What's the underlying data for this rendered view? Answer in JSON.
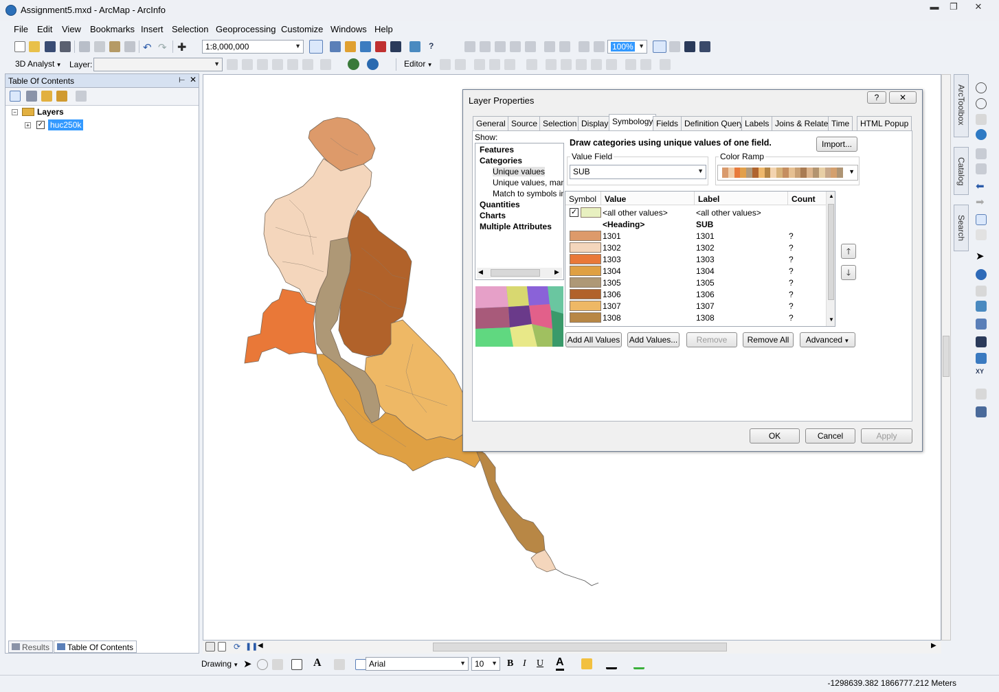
{
  "window": {
    "title": "Assignment5.mxd - ArcMap - ArcInfo",
    "minimize_glyph": "▬",
    "maximize_glyph": "❐",
    "close_glyph": "✕"
  },
  "menu": [
    "File",
    "Edit",
    "View",
    "Bookmarks",
    "Insert",
    "Selection",
    "Geoprocessing",
    "Customize",
    "Windows",
    "Help"
  ],
  "standard_toolbar": {
    "scale": "1:8,000,000",
    "zoom_percent": "100%"
  },
  "toolbar2": {
    "analyst_label": "3D Analyst",
    "layer_label": "Layer:",
    "editor_label": "Editor"
  },
  "toc": {
    "title": "Table Of Contents",
    "root_label": "Layers",
    "layer_name": "huc250k",
    "tabs": [
      "Results",
      "Table Of Contents"
    ]
  },
  "dialog": {
    "title": "Layer Properties",
    "help_glyph": "?",
    "close_glyph": "✕",
    "tabs": [
      "General",
      "Source",
      "Selection",
      "Display",
      "Symbology",
      "Fields",
      "Definition Query",
      "Labels",
      "Joins & Relates",
      "Time",
      "HTML Popup"
    ],
    "active_tab": "Symbology",
    "show_label": "Show:",
    "show_items": [
      {
        "label": "Features",
        "bold": true
      },
      {
        "label": "Categories",
        "bold": true
      },
      {
        "label": "Unique values",
        "bold": false
      },
      {
        "label": "Unique values, many",
        "bold": false
      },
      {
        "label": "Match to symbols in a",
        "bold": false
      },
      {
        "label": "Quantities",
        "bold": true
      },
      {
        "label": "Charts",
        "bold": true
      },
      {
        "label": "Multiple Attributes",
        "bold": true
      }
    ],
    "description": "Draw categories using unique values of one field.",
    "import_label": "Import...",
    "value_field_label": "Value Field",
    "value_field_value": "SUB",
    "color_ramp_label": "Color Ramp",
    "color_ramp": [
      "#d99a6c",
      "#f0cda8",
      "#e87a3c",
      "#e2a04a",
      "#b09a7c",
      "#b0642e",
      "#eeb86c",
      "#b48444",
      "#f3d4b0",
      "#d7b27a",
      "#c58e60",
      "#e6c092",
      "#c9a074",
      "#a97b52",
      "#dcb48c",
      "#b39470",
      "#e8cfa6",
      "#c8a88a",
      "#d4a06e",
      "#ae9474"
    ],
    "grid_headers": [
      "Symbol",
      "Value",
      "Label",
      "Count"
    ],
    "grid_rows": [
      {
        "value": "<all other values>",
        "label": "<all other values>",
        "count": "",
        "color": "#e8f0c0",
        "checked": true,
        "heading": false
      },
      {
        "value": "<Heading>",
        "label": "SUB",
        "count": "",
        "color": "",
        "checked": false,
        "heading": true
      },
      {
        "value": "1301",
        "label": "1301",
        "count": "?",
        "color": "#dd9a6a",
        "checked": false,
        "heading": false
      },
      {
        "value": "1302",
        "label": "1302",
        "count": "?",
        "color": "#f4d6bc",
        "checked": false,
        "heading": false
      },
      {
        "value": "1303",
        "label": "1303",
        "count": "?",
        "color": "#e97838",
        "checked": false,
        "heading": false
      },
      {
        "value": "1304",
        "label": "1304",
        "count": "?",
        "color": "#dfa043",
        "checked": false,
        "heading": false
      },
      {
        "value": "1305",
        "label": "1305",
        "count": "?",
        "color": "#ae9876",
        "checked": false,
        "heading": false
      },
      {
        "value": "1306",
        "label": "1306",
        "count": "?",
        "color": "#b1622a",
        "checked": false,
        "heading": false
      },
      {
        "value": "1307",
        "label": "1307",
        "count": "?",
        "color": "#eeb865",
        "checked": false,
        "heading": false
      },
      {
        "value": "1308",
        "label": "1308",
        "count": "?",
        "color": "#b88745",
        "checked": false,
        "heading": false
      }
    ],
    "buttons": {
      "add_all": "Add All Values",
      "add_values": "Add Values...",
      "remove": "Remove",
      "remove_all": "Remove All",
      "advanced": "Advanced",
      "ok": "OK",
      "cancel": "Cancel",
      "apply": "Apply"
    }
  },
  "right_dock": {
    "tabs": [
      "ArcToolbox",
      "Catalog",
      "Search"
    ]
  },
  "drawing_toolbar": {
    "drawing_label": "Drawing",
    "font_name": "Arial",
    "font_size": "10",
    "bold": "B",
    "italic": "I",
    "underline": "U",
    "font_color_glyph": "A"
  },
  "status": {
    "coordinates": "-1298639.382  1866777.212 Meters"
  },
  "colors": {
    "map_1301": "#dd9a6a",
    "map_1302": "#f4d6bc",
    "map_1303": "#e97838",
    "map_1304": "#dfa043",
    "map_1305": "#ae9876",
    "map_1306": "#b1622a",
    "map_1307": "#eeb865",
    "map_1308": "#b88745",
    "selection_blue": "#3399ff"
  }
}
